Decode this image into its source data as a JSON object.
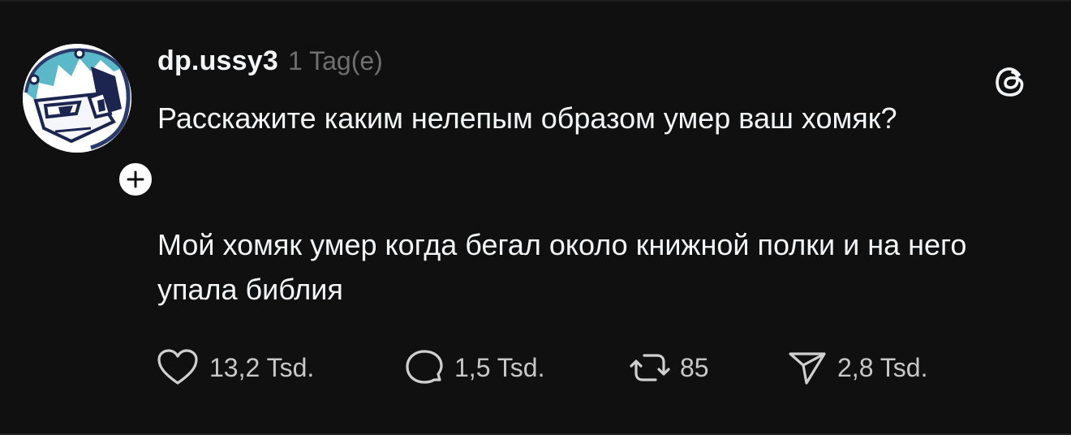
{
  "post": {
    "username": "dp.ussy3",
    "timestamp": "1 Tag(e)",
    "paragraphs": [
      "Расскажите каким нелепым образом умер ваш хомяк?",
      "Мой хомяк умер когда бегал около книжной полки и на него упала библия"
    ]
  },
  "actions": {
    "likes": "13,2 Tsd.",
    "replies": "1,5 Tsd.",
    "reposts": "85",
    "shares": "2,8 Tsd."
  },
  "icons": {
    "like": "heart-icon",
    "reply": "speech-bubble-icon",
    "repost": "repost-icon",
    "share": "paper-plane-icon",
    "logo": "threads-logo-icon",
    "follow": "plus-icon"
  },
  "colors": {
    "background": "#101010",
    "text_primary": "#f3f5f7",
    "text_secondary": "#6f6f6f",
    "avatar_hair": "#5bb8c8",
    "avatar_outline": "#2a3a6a"
  }
}
